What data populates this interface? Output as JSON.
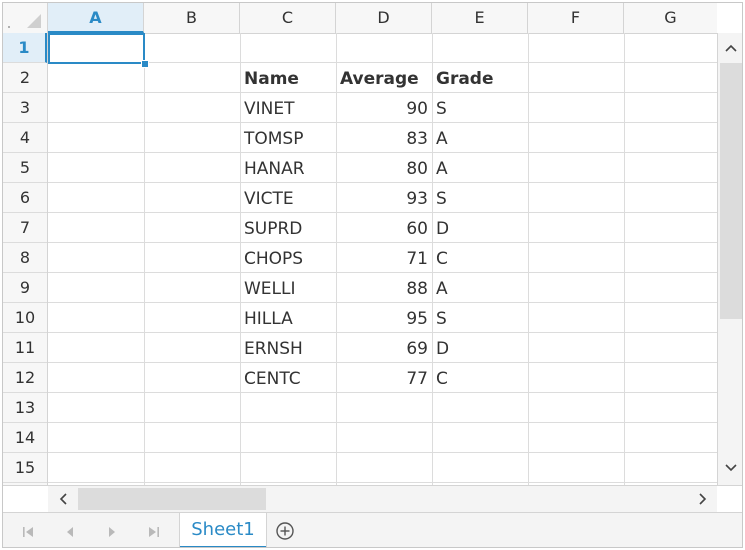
{
  "columns": [
    "A",
    "B",
    "C",
    "D",
    "E",
    "F",
    "G"
  ],
  "rows": [
    "1",
    "2",
    "3",
    "4",
    "5",
    "6",
    "7",
    "8",
    "9",
    "10",
    "11",
    "12",
    "13",
    "14",
    "15"
  ],
  "table": {
    "headers": [
      "Name",
      "Average",
      "Grade"
    ],
    "records": [
      [
        "VINET",
        "90",
        "S"
      ],
      [
        "TOMSP",
        "83",
        "A"
      ],
      [
        "HANAR",
        "80",
        "A"
      ],
      [
        "VICTE",
        "93",
        "S"
      ],
      [
        "SUPRD",
        "60",
        "D"
      ],
      [
        "CHOPS",
        "71",
        "C"
      ],
      [
        "WELLI",
        "88",
        "A"
      ],
      [
        "HILLA",
        "95",
        "S"
      ],
      [
        "ERNSH",
        "69",
        "D"
      ],
      [
        "CENTC",
        "77",
        "C"
      ]
    ]
  },
  "active_cell": "A1",
  "sheet_tabs": [
    {
      "label": "Sheet1",
      "active": true
    }
  ],
  "icons": {
    "tab_nav": [
      "first-sheet-icon",
      "prev-sheet-icon",
      "next-sheet-icon",
      "last-sheet-icon"
    ],
    "add_sheet": "plus-circle-icon"
  },
  "colors": {
    "accent": "#2a8ac6",
    "grid": "#dcdcdc",
    "header_bg": "#f7f7f7"
  }
}
